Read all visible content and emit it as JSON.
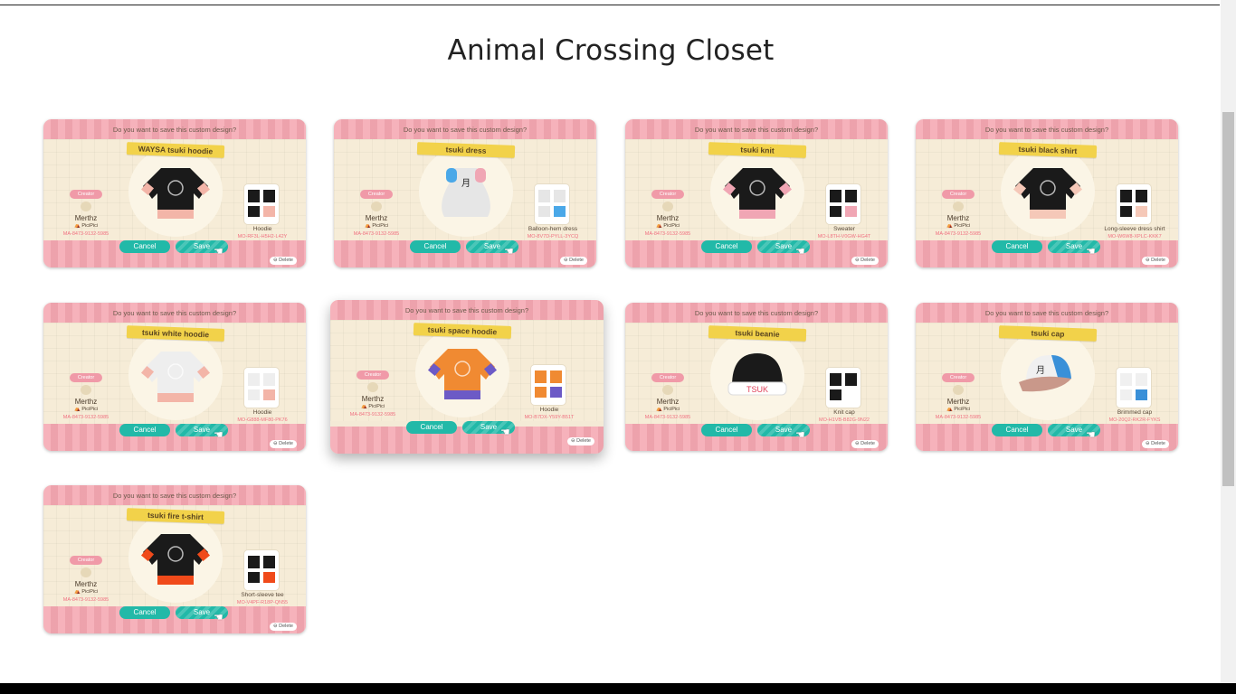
{
  "page": {
    "title": "Animal Crossing Closet"
  },
  "common": {
    "question": "Do you want to save this custom design?",
    "creator_label": "Creator",
    "creator_name": "Merthz",
    "creator_island": "PiciPici",
    "creator_code": "MA-8473-9132-5985",
    "cancel_label": "Cancel",
    "save_label": "Save",
    "delete_label": "Delete"
  },
  "cards": [
    {
      "title": "WAYSA tsuki hoodie",
      "item_type": "Hoodie",
      "design_code": "MO-RF3L-H5H2-L42Y",
      "colors": [
        "#1a1a1a",
        "#f3b5a8"
      ],
      "icon": "hoodie-icon"
    },
    {
      "title": "tsuki dress",
      "item_type": "Balloon-hem dress",
      "design_code": "MO-8V7D-PYLL-3YCQ",
      "colors": [
        "#e6e6e6",
        "#4aa8e8"
      ],
      "icon": "dress-icon"
    },
    {
      "title": "tsuki knit",
      "item_type": "Sweater",
      "design_code": "MO-L8TH-V0GW-HG4T",
      "colors": [
        "#1a1a1a",
        "#f0a6b4"
      ],
      "icon": "sweater-icon"
    },
    {
      "title": "tsuki black shirt",
      "item_type": "Long-sleeve dress shirt",
      "design_code": "MO-W6W8-XPLC-KKK7",
      "colors": [
        "#1a1a1a",
        "#f5c8b8"
      ],
      "icon": "shirt-icon"
    },
    {
      "title": "tsuki white hoodie",
      "item_type": "Hoodie",
      "design_code": "MO-G888-MF80-PK76",
      "colors": [
        "#eeeeee",
        "#f3b5a8"
      ],
      "icon": "hoodie-icon"
    },
    {
      "title": "tsuki space hoodie",
      "item_type": "Hoodie",
      "design_code": "MO-B7DX-Y59Y-B51T",
      "colors": [
        "#f08a32",
        "#6c5ac6"
      ],
      "icon": "hoodie-icon"
    },
    {
      "title": "tsuki beanie",
      "item_type": "Knit cap",
      "design_code": "MO-H1VB-B82G-9N22",
      "colors": [
        "#1a1a1a",
        "#ffffff"
      ],
      "icon": "knit-cap-icon"
    },
    {
      "title": "tsuki cap",
      "item_type": "Brimmed cap",
      "design_code": "MO-20Q2-RK2R-FYKS",
      "colors": [
        "#f0f0f0",
        "#3a90d8"
      ],
      "icon": "cap-icon"
    },
    {
      "title": "tsuki fire t-shirt",
      "item_type": "Short-sleeve tee",
      "design_code": "MO-V4PF-R18P-QN55",
      "colors": [
        "#1a1a1a",
        "#f04a1a"
      ],
      "icon": "tee-icon"
    }
  ]
}
